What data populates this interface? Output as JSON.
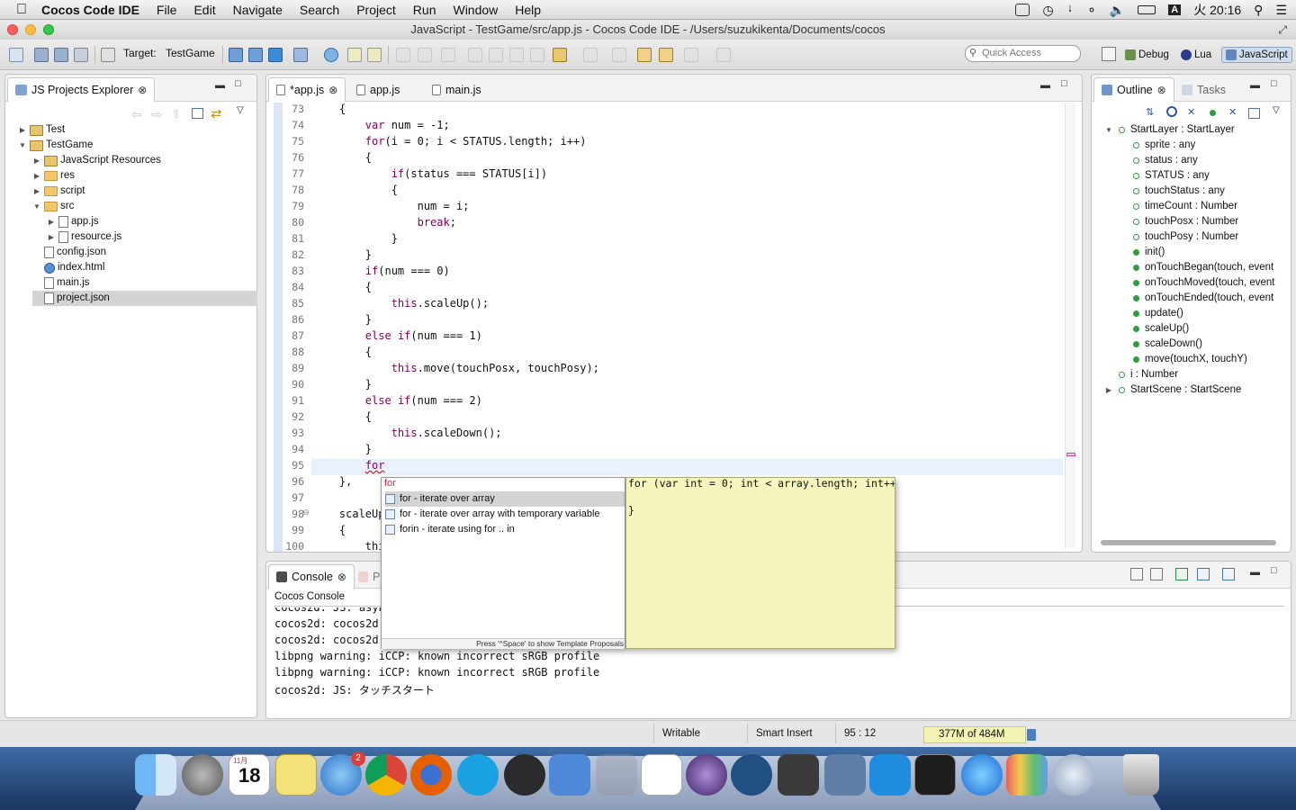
{
  "menubar": {
    "app_name": "Cocos Code IDE",
    "items": [
      "File",
      "Edit",
      "Navigate",
      "Search",
      "Project",
      "Run",
      "Window",
      "Help"
    ],
    "status_letter": "A",
    "clock": "火 20:16"
  },
  "window": {
    "title": "JavaScript - TestGame/src/app.js - Cocos Code IDE - /Users/suzukikenta/Documents/cocos"
  },
  "toolbar": {
    "target_label": "Target:",
    "target_value": "TestGame",
    "quick_access_placeholder": "Quick Access",
    "perspectives": [
      "Debug",
      "Lua",
      "JavaScript"
    ]
  },
  "explorer": {
    "title": "JS Projects Explorer",
    "tree": [
      {
        "label": "Test",
        "depth": 0,
        "toggle": "▶",
        "kind": "proj"
      },
      {
        "label": "TestGame",
        "depth": 0,
        "toggle": "▼",
        "kind": "proj"
      },
      {
        "label": "JavaScript Resources",
        "depth": 1,
        "toggle": "▶",
        "kind": "lib"
      },
      {
        "label": "res",
        "depth": 1,
        "toggle": "▶",
        "kind": "folder"
      },
      {
        "label": "script",
        "depth": 1,
        "toggle": "▶",
        "kind": "folder"
      },
      {
        "label": "src",
        "depth": 1,
        "toggle": "▼",
        "kind": "folder"
      },
      {
        "label": "app.js",
        "depth": 2,
        "toggle": "▶",
        "kind": "js"
      },
      {
        "label": "resource.js",
        "depth": 2,
        "toggle": "▶",
        "kind": "js"
      },
      {
        "label": "config.json",
        "depth": 1,
        "toggle": "",
        "kind": "file"
      },
      {
        "label": "index.html",
        "depth": 1,
        "toggle": "",
        "kind": "html"
      },
      {
        "label": "main.js",
        "depth": 1,
        "toggle": "",
        "kind": "file"
      },
      {
        "label": "project.json",
        "depth": 1,
        "toggle": "",
        "kind": "file",
        "selected": true
      }
    ]
  },
  "editor": {
    "tabs": [
      {
        "label": "*app.js",
        "active": true,
        "close": true
      },
      {
        "label": "app.js",
        "active": false,
        "close": false
      },
      {
        "label": "main.js",
        "active": false,
        "close": false
      }
    ],
    "lines": [
      {
        "n": "73",
        "code": "    {"
      },
      {
        "n": "74",
        "code": "        var num = -1;"
      },
      {
        "n": "75",
        "code": "        for(i = 0; i < STATUS.length; i++)"
      },
      {
        "n": "76",
        "code": "        {"
      },
      {
        "n": "77",
        "code": "            if(status === STATUS[i])"
      },
      {
        "n": "78",
        "code": "            {"
      },
      {
        "n": "79",
        "code": "                num = i;"
      },
      {
        "n": "80",
        "code": "                break;"
      },
      {
        "n": "81",
        "code": "            }"
      },
      {
        "n": "82",
        "code": "        }"
      },
      {
        "n": "83",
        "code": "        if(num === 0)"
      },
      {
        "n": "84",
        "code": "        {"
      },
      {
        "n": "85",
        "code": "            this.scaleUp();"
      },
      {
        "n": "86",
        "code": "        }"
      },
      {
        "n": "87",
        "code": "        else if(num === 1)"
      },
      {
        "n": "88",
        "code": "        {"
      },
      {
        "n": "89",
        "code": "            this.move(touchPosx, touchPosy);"
      },
      {
        "n": "90",
        "code": "        }"
      },
      {
        "n": "91",
        "code": "        else if(num === 2)"
      },
      {
        "n": "92",
        "code": "        {"
      },
      {
        "n": "93",
        "code": "            this.scaleDown();"
      },
      {
        "n": "94",
        "code": "        }"
      },
      {
        "n": "95",
        "code": "        for"
      },
      {
        "n": "96",
        "code": "    },"
      },
      {
        "n": "97",
        "code": ""
      },
      {
        "n": "98",
        "code": "    scaleUp"
      },
      {
        "n": "99",
        "code": "    {"
      },
      {
        "n": "100",
        "code": "        thi"
      }
    ]
  },
  "autocomplete": {
    "filter": "for",
    "items": [
      "for - iterate over array",
      "for - iterate over array with temporary variable",
      "forin - iterate using for .. in"
    ],
    "hint": "Press '^Space' to show Template Proposals",
    "preview_line1": "for (var int = 0; int < array.length; int++",
    "preview_line2": "}"
  },
  "outline": {
    "tabs": [
      "Outline",
      "Tasks"
    ],
    "items": [
      {
        "label": "StartLayer : StartLayer",
        "depth": 0,
        "toggle": "▼",
        "hollow": true
      },
      {
        "label": "sprite : any",
        "depth": 1,
        "toggle": "",
        "hollow": true
      },
      {
        "label": "status : any",
        "depth": 1,
        "toggle": "",
        "hollow": true
      },
      {
        "label": "STATUS : any",
        "depth": 1,
        "toggle": "",
        "hollow": true
      },
      {
        "label": "touchStatus : any",
        "depth": 1,
        "toggle": "",
        "hollow": true
      },
      {
        "label": "timeCount : Number",
        "depth": 1,
        "toggle": "",
        "hollow": true
      },
      {
        "label": "touchPosx : Number",
        "depth": 1,
        "toggle": "",
        "hollow": true
      },
      {
        "label": "touchPosy : Number",
        "depth": 1,
        "toggle": "",
        "hollow": true
      },
      {
        "label": "init()",
        "depth": 1,
        "toggle": "",
        "hollow": false
      },
      {
        "label": "onTouchBegan(touch, event",
        "depth": 1,
        "toggle": "",
        "hollow": false
      },
      {
        "label": "onTouchMoved(touch, event",
        "depth": 1,
        "toggle": "",
        "hollow": false
      },
      {
        "label": "onTouchEnded(touch, event",
        "depth": 1,
        "toggle": "",
        "hollow": false
      },
      {
        "label": "update()",
        "depth": 1,
        "toggle": "",
        "hollow": false
      },
      {
        "label": "scaleUp()",
        "depth": 1,
        "toggle": "",
        "hollow": false
      },
      {
        "label": "scaleDown()",
        "depth": 1,
        "toggle": "",
        "hollow": false
      },
      {
        "label": "move(touchX, touchY)",
        "depth": 1,
        "toggle": "",
        "hollow": false
      },
      {
        "label": "i : Number",
        "depth": 0,
        "toggle": "",
        "hollow": true
      },
      {
        "label": "StartScene : StartScene",
        "depth": 0,
        "toggle": "▶",
        "hollow": true
      }
    ]
  },
  "console": {
    "tab": "Console",
    "tab2_initial": "P",
    "subtitle": "Cocos Console",
    "lines": [
      "cocos2d: JS: asyn",
      "cocos2d: cocos2d:",
      "cocos2d: cocos2d:",
      "libpng warning: iCCP: known incorrect sRGB profile",
      "libpng warning: iCCP: known incorrect sRGB profile",
      "cocos2d: JS: タッチスタート"
    ]
  },
  "statusbar": {
    "mode": "Writable",
    "insert": "Smart Insert",
    "position": "95 : 12",
    "memory": "377M of 484M"
  },
  "dock": {
    "calendar_month": "11月",
    "calendar_day": "18",
    "badge": "2",
    "apps": [
      "finder",
      "launchpad",
      "calendar",
      "stickies",
      "app-store",
      "chrome",
      "firefox",
      "skype",
      "unity",
      "xcode",
      "help",
      "slack-like",
      "eclipse",
      "sourcetree",
      "sublime",
      "monodevelop",
      "cocos",
      "terminal",
      "itunes",
      "keynote",
      "network",
      "trash"
    ]
  },
  "colors": {
    "keyword": "#7f0055",
    "selection": "#d4d4d4",
    "highlight_line": "#e8f2fe",
    "doc_bg": "#f5f5bc"
  }
}
